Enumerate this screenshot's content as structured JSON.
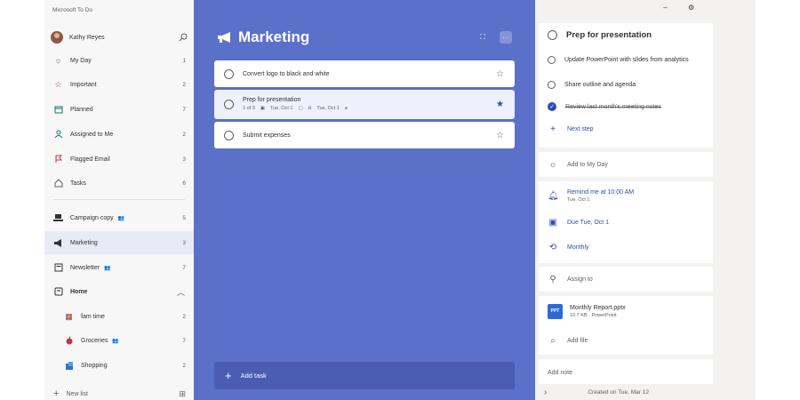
{
  "app": {
    "title": "Microsoft To Do"
  },
  "user": {
    "name": "Kathy Reyes"
  },
  "sidebar": {
    "smart_lists": [
      {
        "label": "My Day",
        "count": "1",
        "icon": "sun-icon"
      },
      {
        "label": "Important",
        "count": "2",
        "icon": "star-icon"
      },
      {
        "label": "Planned",
        "count": "7",
        "icon": "calendar-icon"
      },
      {
        "label": "Assigned to Me",
        "count": "2",
        "icon": "person-icon"
      },
      {
        "label": "Flagged Email",
        "count": "3",
        "icon": "flag-icon"
      },
      {
        "label": "Tasks",
        "count": "6",
        "icon": "home-icon"
      }
    ],
    "lists": [
      {
        "label": "Campaign copy",
        "count": "5",
        "shared": true
      },
      {
        "label": "Marketing",
        "count": "3",
        "shared": false,
        "active": true
      },
      {
        "label": "Newsletter",
        "count": "7",
        "shared": true
      }
    ],
    "group": {
      "label": "Home",
      "items": [
        {
          "label": "fam time",
          "count": "2",
          "shared": false
        },
        {
          "label": "Groceries",
          "count": "7",
          "shared": true
        },
        {
          "label": "Shopping",
          "count": "2",
          "shared": false
        }
      ]
    },
    "new_list": "New list"
  },
  "main": {
    "title": "Marketing",
    "accent": "#5b70c9",
    "tasks": [
      {
        "title": "Convert logo to black and white",
        "starred": false
      },
      {
        "title": "Prep for presentation",
        "starred": true,
        "meta": [
          "1 of 3",
          "Tue, Oct 1",
          "Tue, Oct 1"
        ]
      },
      {
        "title": "Submit expenses",
        "starred": false
      }
    ],
    "add_task": "Add task"
  },
  "detail": {
    "title": "Prep for presentation",
    "steps": [
      {
        "text": "Update PowerPoint with slides from analytics",
        "done": false
      },
      {
        "text": "Share outline and agenda",
        "done": false
      },
      {
        "text": "Review last month's meeting notes",
        "done": true
      }
    ],
    "next_step": "Next step",
    "add_my_day": "Add to My Day",
    "remind": {
      "label": "Remind me at 10:00 AM",
      "sub": "Tue, Oct 1"
    },
    "due": "Due Tue, Oct 1",
    "repeat": "Monthly",
    "assign": "Assign to",
    "file": {
      "name": "Monthly Report.pptx",
      "meta": "10.7 KB · PowerPoint",
      "badge": "PPT"
    },
    "add_file": "Add file",
    "add_note": "Add note",
    "created": "Created on Tue, Mar 12"
  }
}
